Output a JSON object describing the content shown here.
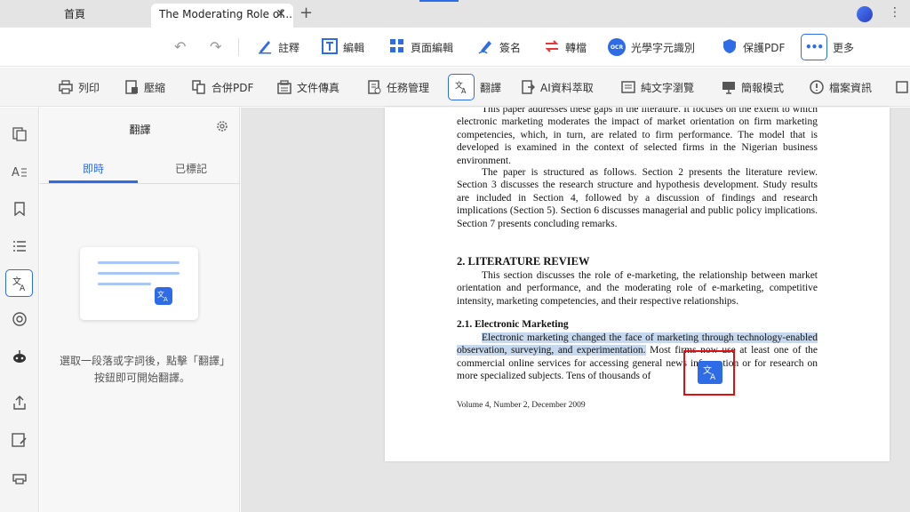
{
  "tabs": {
    "home_label": "首頁",
    "doc_label": "The Moderating Role of...",
    "close": "✕",
    "add": "+"
  },
  "toolbar1": {
    "items": [
      {
        "label": "註釋",
        "icon": "pen-icon"
      },
      {
        "label": "編輯",
        "icon": "text-edit-icon"
      },
      {
        "label": "頁面編輯",
        "icon": "pages-icon"
      },
      {
        "label": "簽名",
        "icon": "signature-icon"
      },
      {
        "label": "轉檔",
        "icon": "convert-icon"
      },
      {
        "label": "光學字元識別",
        "icon": "ocr-icon"
      },
      {
        "label": "保護PDF",
        "icon": "shield-icon"
      },
      {
        "label": "更多",
        "icon": "more-icon"
      }
    ],
    "ocr_badge": "OCR",
    "more_dots": "•••"
  },
  "toolbar2": {
    "items": [
      {
        "label": "列印",
        "icon": "print-icon"
      },
      {
        "label": "壓縮",
        "icon": "compress-icon"
      },
      {
        "label": "合併PDF",
        "icon": "merge-icon"
      },
      {
        "label": "文件傳真",
        "icon": "fax-icon"
      },
      {
        "label": "任務管理",
        "icon": "task-icon"
      },
      {
        "label": "翻譯",
        "icon": "translate-icon"
      },
      {
        "label": "AI資料萃取",
        "icon": "ai-extract-icon"
      },
      {
        "label": "純文字瀏覽",
        "icon": "text-view-icon"
      },
      {
        "label": "簡報模式",
        "icon": "presentation-icon"
      },
      {
        "label": "檔案資訊",
        "icon": "info-icon"
      }
    ]
  },
  "panel": {
    "title": "翻譯",
    "tab_live": "即時",
    "tab_marked": "已標記",
    "hint": "選取一段落或字詞後，點擊「翻譯」按鈕即可開始翻譯。"
  },
  "ai_button": "Ai",
  "document": {
    "p1": "This paper addresses these gaps in the literature. It focuses on the extent to which electronic marketing moderates the impact of market orientation on firm marketing competencies, which, in turn, are related to firm performance. The model that is developed is examined in the context of selected firms in the Nigerian business environment.",
    "p2": "The paper is structured as follows. Section 2 presents the literature review. Section 3 discusses the research structure and hypothesis development. Study results are included in Section 4, followed by a discussion of findings and research implications (Section 5). Section 6 discusses managerial and public policy implications. Section 7 presents concluding remarks.",
    "section_heading": "2.   LITERATURE REVIEW",
    "p3": "This section discusses the role of e-marketing, the relationship between market orientation and performance, and the moderating role of e-marketing, competitive intensity, marketing competencies, and their respective relationships.",
    "subsection_heading": "2.1.  Electronic Marketing",
    "p4_highlight": "Electronic marketing changed the face of marketing through technology-enabled observation, surveying, and experimentation.",
    "p4_rest": " Most firms now use at least one of the commercial online services for accessing general news information or for research on more specialized subjects. Tens of thousands of",
    "footer": "Volume 4, Number 2, December 2009"
  }
}
